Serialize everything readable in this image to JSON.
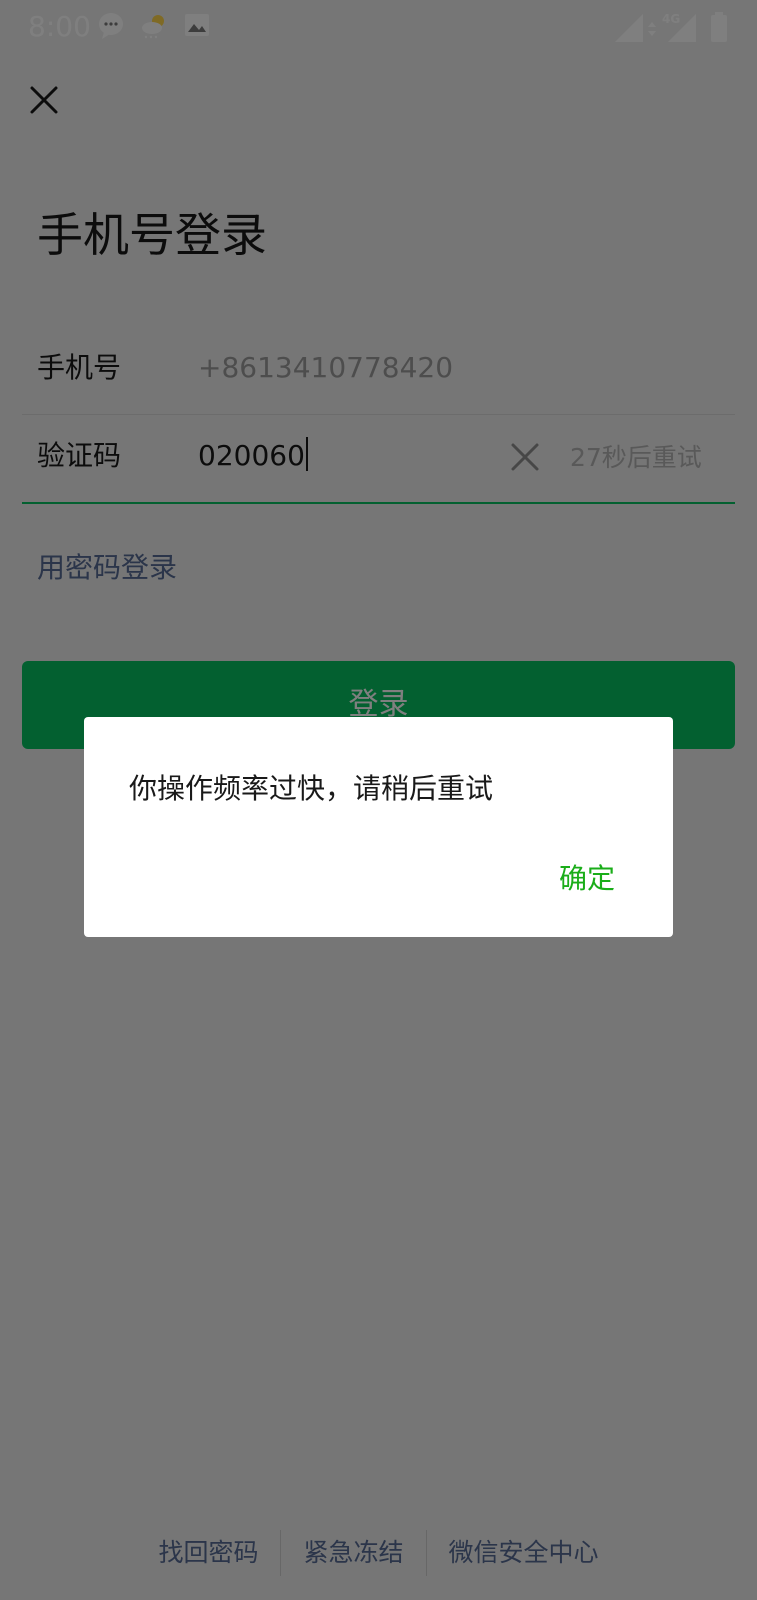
{
  "status_bar": {
    "time": "8:00",
    "network": "4G"
  },
  "page": {
    "title": "手机号登录"
  },
  "form": {
    "phone_label": "手机号",
    "phone_value": "+8613410778420",
    "code_label": "验证码",
    "code_value": "020060",
    "retry_text": "27秒后重试"
  },
  "password_login_link": "用密码登录",
  "login_button": "登录",
  "footer": {
    "links": [
      "找回密码",
      "紧急冻结",
      "微信安全中心"
    ]
  },
  "dialog": {
    "message": "你操作频率过快，请稍后重试",
    "confirm": "确定"
  },
  "colors": {
    "accent": "#07c160",
    "link": "#576b95",
    "dialog_confirm": "#1aad19"
  }
}
